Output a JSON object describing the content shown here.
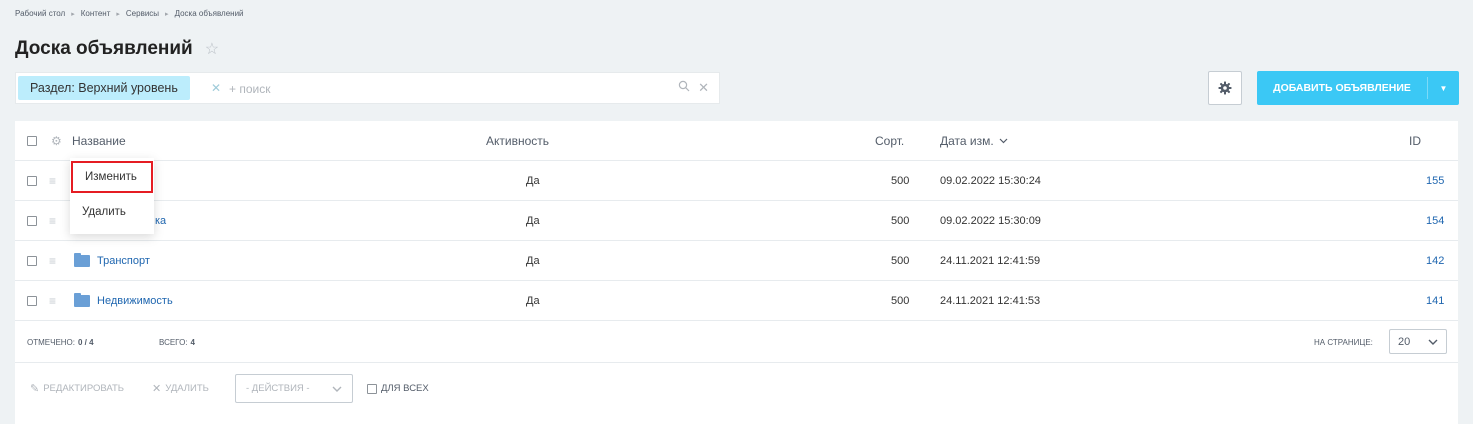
{
  "breadcrumb": [
    "Рабочий стол",
    "Контент",
    "Сервисы",
    "Доска объявлений"
  ],
  "page": {
    "title": "Доска объявлений"
  },
  "filter": {
    "chip": "Раздел: Верхний уровень",
    "placeholder": "+ поиск"
  },
  "toolbar": {
    "add_label": "ДОБАВИТЬ ОБЪЯВЛЕНИЕ"
  },
  "grid": {
    "headers": {
      "name": "Название",
      "active": "Активность",
      "sort": "Сорт.",
      "date": "Дата изм.",
      "id": "ID"
    },
    "rows": [
      {
        "name": "",
        "active": "Да",
        "sort": "500",
        "date": "09.02.2022 15:30:24",
        "id": "155"
      },
      {
        "name": "ка",
        "active": "Да",
        "sort": "500",
        "date": "09.02.2022 15:30:09",
        "id": "154"
      },
      {
        "name": "Транспорт",
        "active": "Да",
        "sort": "500",
        "date": "24.11.2021 12:41:59",
        "id": "142"
      },
      {
        "name": "Недвижимость",
        "active": "Да",
        "sort": "500",
        "date": "24.11.2021 12:41:53",
        "id": "141"
      }
    ]
  },
  "footer": {
    "selected_label": "ОТМЕЧЕНО:",
    "selected_value": "0 / 4",
    "total_label": "ВСЕГО:",
    "total_value": "4",
    "per_page_label": "НА СТРАНИЦЕ:",
    "per_page_value": "20",
    "edit_label": "РЕДАКТИРОВАТЬ",
    "delete_label": "УДАЛИТЬ",
    "actions_label": "- ДЕЙСТВИЯ -",
    "for_all_label": "ДЛЯ ВСЕХ"
  },
  "context_menu": {
    "edit": "Изменить",
    "delete": "Удалить"
  },
  "colors": {
    "accent": "#3bc8f5",
    "link": "#2067b0",
    "highlight": "#e51c23",
    "chip": "#bcedfc"
  }
}
